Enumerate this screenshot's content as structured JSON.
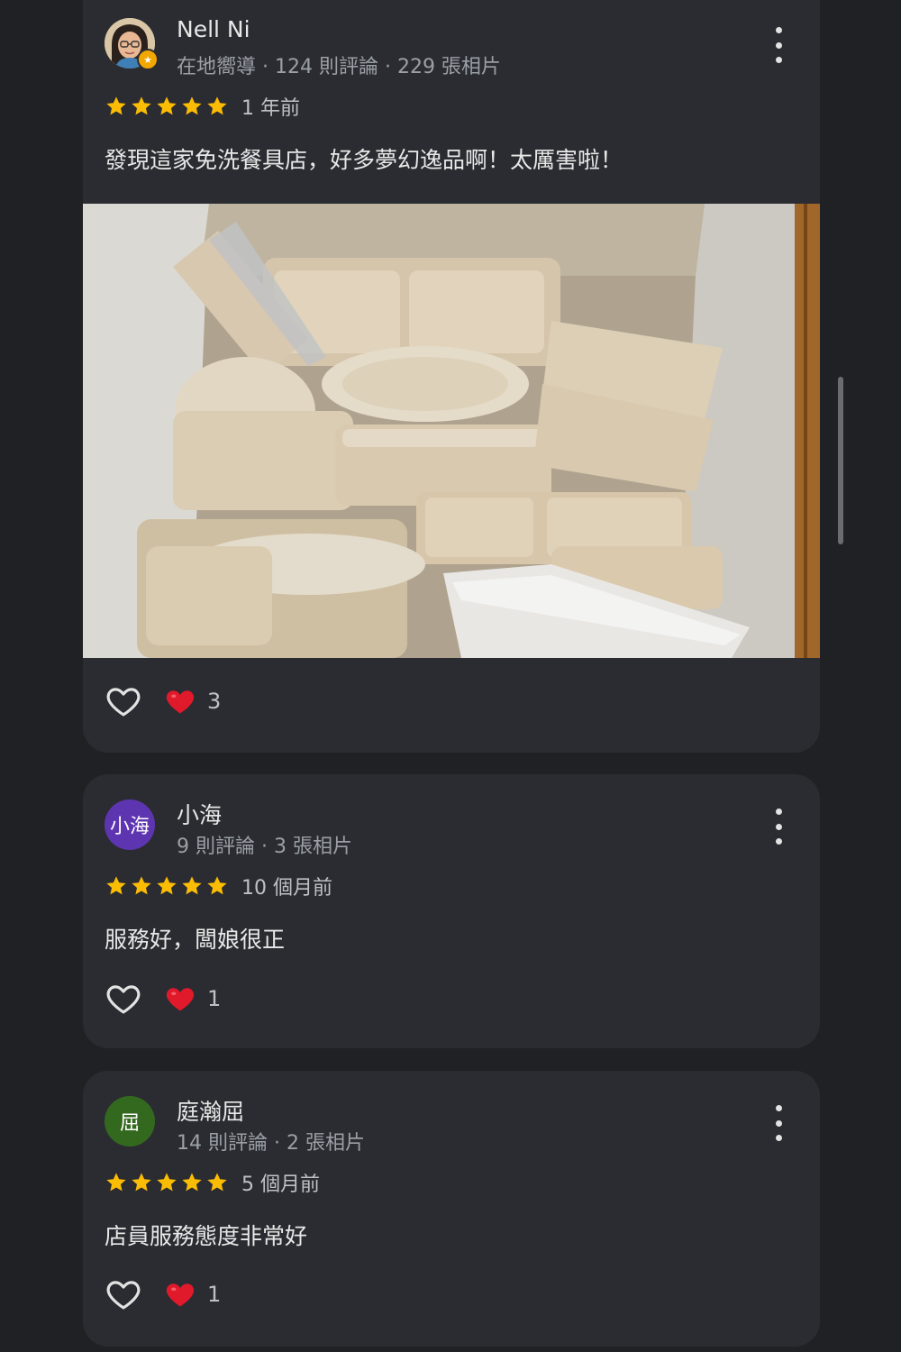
{
  "reviews": [
    {
      "name": "Nell Ni",
      "meta": "在地嚮導 · 124 則評論 · 229 張相片",
      "rating": 5,
      "time": "1 年前",
      "text": "發現這家免洗餐具店，好多夢幻逸品啊！太厲害啦！",
      "likes": "3",
      "has_photo": true
    },
    {
      "name": "小海",
      "avatar_text": "小海",
      "avatar_color": "#5e35b1",
      "meta": "9 則評論 · 3 張相片",
      "rating": 5,
      "time": "10 個月前",
      "text": "服務好，闆娘很正",
      "likes": "1"
    },
    {
      "name": "庭瀚屈",
      "avatar_text": "屈",
      "avatar_color": "#33691e",
      "meta": "14 則評論 · 2 張相片",
      "rating": 5,
      "time": "5 個月前",
      "text": "店員服務態度非常好",
      "likes": "1"
    }
  ],
  "colors": {
    "background": "#202124",
    "card": "#2b2c31",
    "star": "#fbbc04",
    "heart": "#e0192b"
  },
  "icons": {
    "like": "heart-outline-icon",
    "reaction": "red-heart-icon",
    "menu": "more-vert-icon",
    "guide_badge": "local-guide-badge-icon"
  }
}
